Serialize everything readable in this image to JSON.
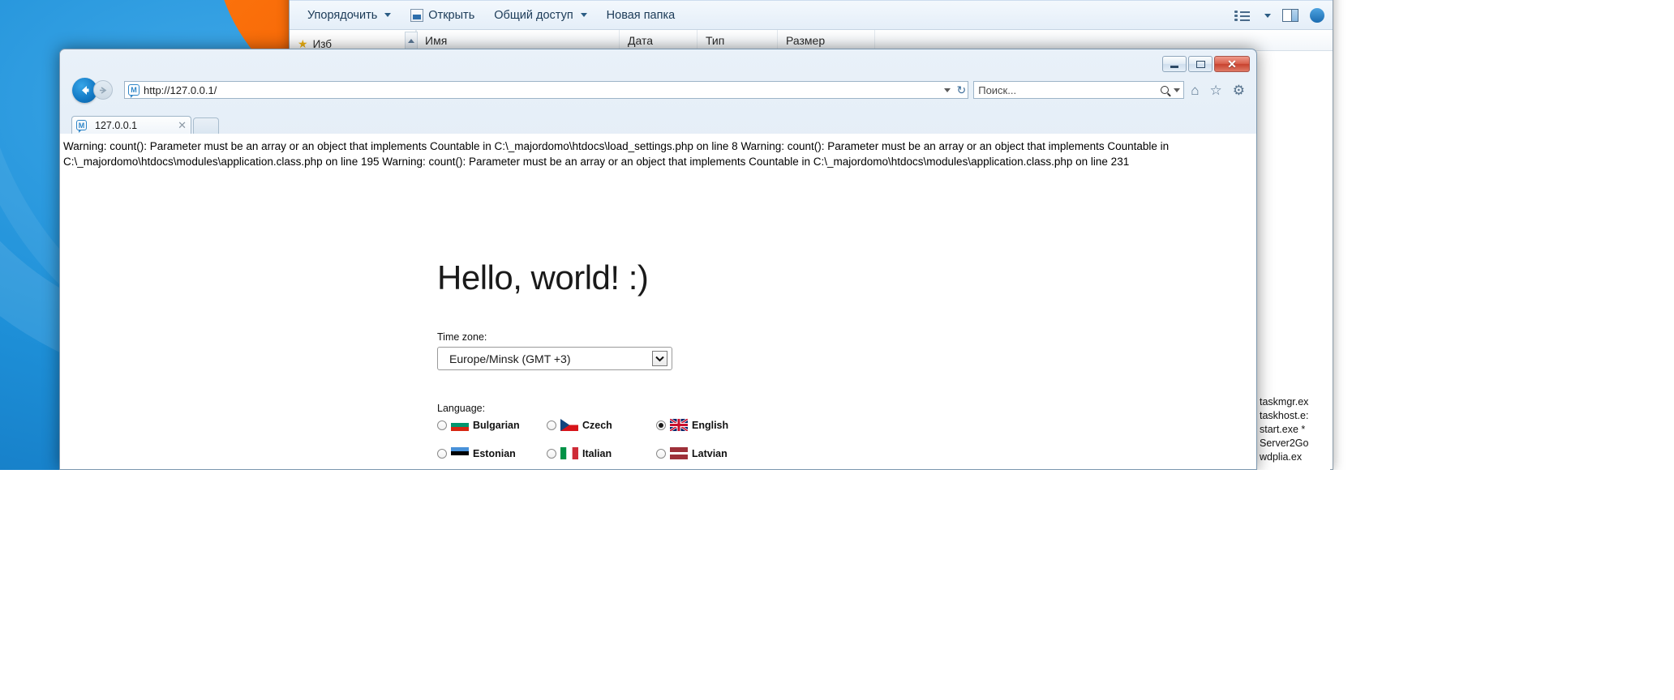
{
  "desktop": {
    "name": "windows-desktop"
  },
  "explorer": {
    "toolbar": [
      {
        "label": "Упорядочить",
        "icon": "none",
        "caret": true
      },
      {
        "label": "Открыть",
        "icon": "open-icon",
        "caret": false
      },
      {
        "label": "Общий доступ",
        "icon": "none",
        "caret": true
      },
      {
        "label": "Новая папка",
        "icon": "none",
        "caret": false
      }
    ],
    "columns": [
      "Имя",
      "Дата изменения",
      "Тип",
      "Размер"
    ],
    "nav_items": [
      "Изб"
    ],
    "right_icons": [
      "list-view-icon",
      "chevron-down-icon",
      "preview-pane-icon",
      "help-icon"
    ]
  },
  "process_list": {
    "rows": [
      "taskmgr.ex",
      "taskhost.e:",
      "start.exe *",
      "Server2Go",
      "wdplia.ex"
    ]
  },
  "browser": {
    "window_controls": {
      "minimize": "–",
      "maximize": "□",
      "close": "✕"
    },
    "nav": {
      "back_label": "←",
      "forward_label": "→",
      "refresh_icon": "refresh-icon"
    },
    "address": {
      "value": "http://127.0.0.1/",
      "favicon": "M"
    },
    "search": {
      "placeholder": "Поиск..."
    },
    "toolbar_icons": [
      "home-icon",
      "favorites-star-icon",
      "settings-gear-icon"
    ],
    "tab": {
      "title": "127.0.0.1",
      "favicon": "M",
      "close": "✕"
    }
  },
  "page": {
    "warning_text": "Warning: count(): Parameter must be an array or an object that implements Countable in C:\\_majordomo\\htdocs\\load_settings.php on line 8 Warning: count(): Parameter must be an array or an object that implements Countable in C:\\_majordomo\\htdocs\\modules\\application.class.php on line 195 Warning: count(): Parameter must be an array or an object that implements Countable in C:\\_majordomo\\htdocs\\modules\\application.class.php on line 231",
    "heading": "Hello, world! :)",
    "timezone": {
      "label": "Time zone:",
      "value": "Europe/Minsk (GMT +3)",
      "arrow": "⌄"
    },
    "language": {
      "label": "Language:",
      "options": [
        {
          "name": "Bulgarian",
          "selected": false,
          "flag": "bulgaria"
        },
        {
          "name": "Czech",
          "selected": false,
          "flag": "czech"
        },
        {
          "name": "English",
          "selected": true,
          "flag": "uk"
        },
        {
          "name": "Estonian",
          "selected": false,
          "flag": "estonia"
        },
        {
          "name": "Italian",
          "selected": false,
          "flag": "italy"
        },
        {
          "name": "Latvian",
          "selected": false,
          "flag": "latvia"
        }
      ]
    }
  },
  "colors": {
    "desktop_blue": "#1e90d8",
    "accent_orange": "#f05a00",
    "close_red": "#c8432f",
    "chrome_blue": "#d3e2f0"
  }
}
